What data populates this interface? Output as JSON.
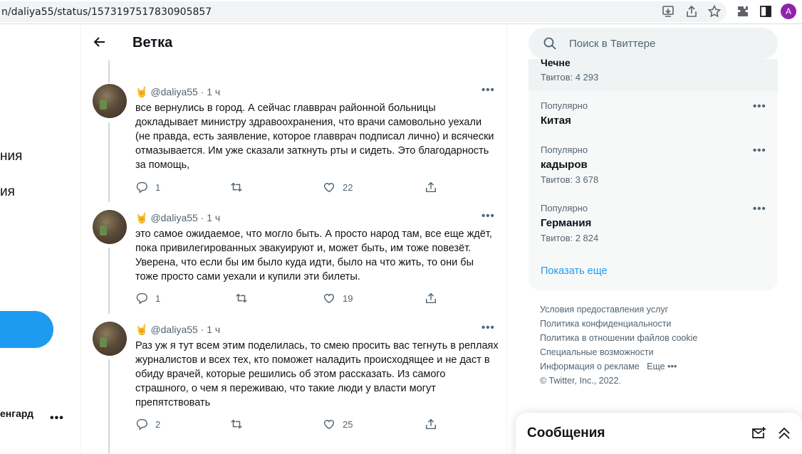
{
  "browser": {
    "url": "n/daliya55/status/1573197517830905857",
    "avatar_letter": "A"
  },
  "left_nav": {
    "fragments": [
      "ния",
      "ия"
    ],
    "account_name": "енгард",
    "account_more": "•••"
  },
  "header": {
    "title": "Ветка"
  },
  "tweets": [
    {
      "emoji": "🤘",
      "handle": "@daliya55",
      "time": "· 1 ч",
      "more": "•••",
      "text": "все вернулись в город. А сейчас главврач районной больницы докладывает министру здравоохранения, что врачи самовольно уехали (не правда, есть заявление, которое главврач подписал лично) и всячески отмазывается. Им уже сказали заткнуть рты и сидеть. Это благодарность за помощь,",
      "replies": "1",
      "retweets": "",
      "likes": "22"
    },
    {
      "emoji": "🤘",
      "handle": "@daliya55",
      "time": "· 1 ч",
      "more": "•••",
      "text": "это самое ожидаемое, что могло быть. А просто народ там, все еще ждёт, пока привилегированных эвакуируют и, может быть, им тоже повезёт. Уверена, что если бы им было куда идти, было на что жить, то они бы тоже просто сами уехали и купили эти билеты.",
      "replies": "1",
      "retweets": "",
      "likes": "19"
    },
    {
      "emoji": "🤘",
      "handle": "@daliya55",
      "time": "· 1 ч",
      "more": "•••",
      "text": "Раз уж я тут всем этим поделилась, то смею просить вас тегнуть в реплаях журналистов и всех тех, кто поможет наладить происходящее и не даст в обиду врачей, которые решились об этом рассказать. Из самого страшного, о чем я переживаю, что такие люди у власти могут препятствовать",
      "replies": "2",
      "retweets": "",
      "likes": "25"
    }
  ],
  "search": {
    "placeholder": "Поиск в Твиттере"
  },
  "trends": {
    "top_cut_name": "Чечне",
    "top_count": "Твитов: 4 293",
    "items": [
      {
        "category": "Популярно",
        "name": "Китая",
        "count": ""
      },
      {
        "category": "Популярно",
        "name": "кадыров",
        "count": "Твитов: 3 678"
      },
      {
        "category": "Популярно",
        "name": "Германия",
        "count": "Твитов: 2 824"
      }
    ],
    "more_icon": "•••",
    "show_more": "Показать еще"
  },
  "footer": {
    "terms": "Условия предоставления услуг",
    "privacy": "Политика конфиденциальности",
    "cookies": "Политика в отношении файлов cookie",
    "accessibility": "Специальные возможности",
    "ads": "Информация о рекламе",
    "more": "Еще •••",
    "copyright": "© Twitter, Inc., 2022."
  },
  "messages": {
    "title": "Сообщения"
  },
  "colors": {
    "accent": "#1d9bf0",
    "muted": "#536471",
    "text": "#0f1419"
  }
}
